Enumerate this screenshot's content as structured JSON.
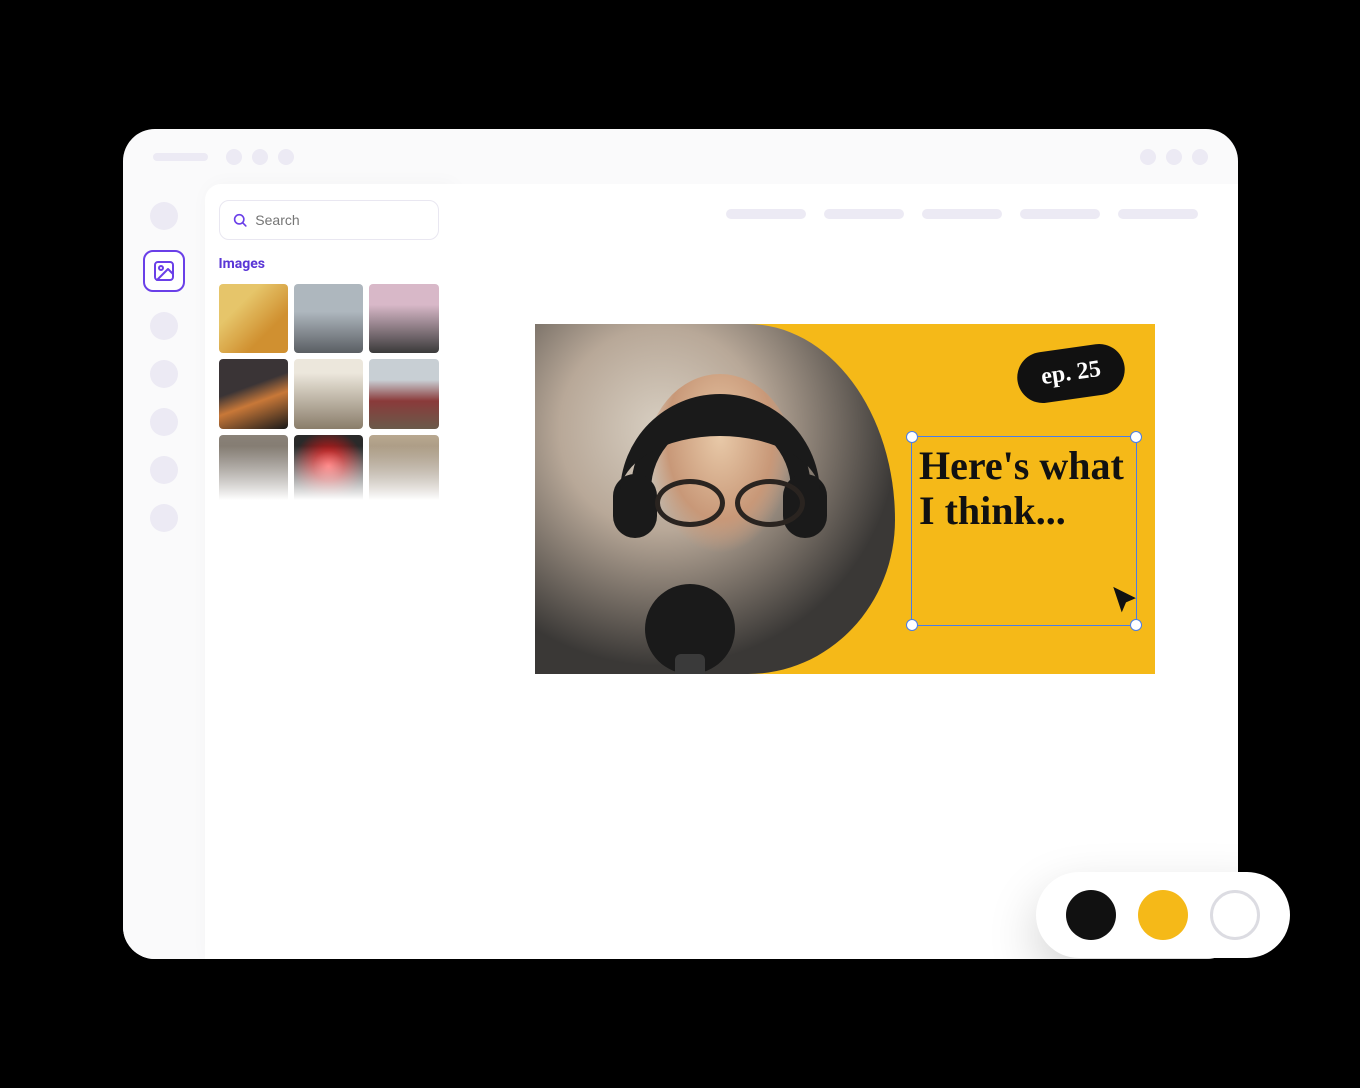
{
  "search": {
    "placeholder": "Search"
  },
  "panel": {
    "heading": "Images"
  },
  "design": {
    "badge": "ep. 25",
    "headline": "Here's what I think..."
  },
  "colors": {
    "black": "#111111",
    "yellow": "#f5b918",
    "white": "#ffffff"
  }
}
